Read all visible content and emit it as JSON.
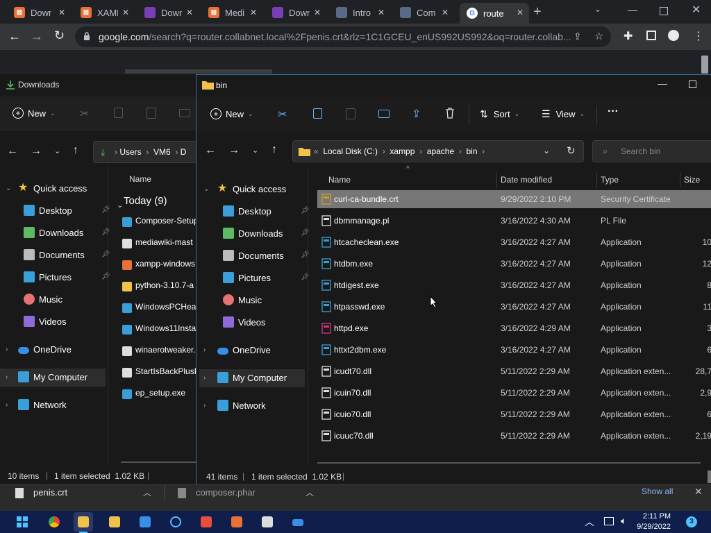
{
  "chrome": {
    "tabs": [
      {
        "title": "Down",
        "fav_color": "#e8703a",
        "fav_text": "⊠"
      },
      {
        "title": "XAMP",
        "fav_color": "#e8703a",
        "fav_text": "⊠"
      },
      {
        "title": "Down",
        "fav_color": "#7b3fb5",
        "fav_text": ""
      },
      {
        "title": "Medi",
        "fav_color": "#e8703a",
        "fav_text": "⊠"
      },
      {
        "title": "Down",
        "fav_color": "#7b3fb5",
        "fav_text": ""
      },
      {
        "title": "Intro",
        "fav_color": "#5a6a8a",
        "fav_text": ""
      },
      {
        "title": "Com",
        "fav_color": "#5a6a8a",
        "fav_text": ""
      },
      {
        "title": "route",
        "fav_color": "#ffffff",
        "fav_text": "G"
      }
    ],
    "url_host": "google.com",
    "url_rest": "/search?q=router.collabnet.local%2Fpenis.crt&rlz=1C1GCEU_enUS992US992&oq=router.collab..."
  },
  "back_window": {
    "title": "Downloads",
    "new_label": "New",
    "breadcrumb": [
      "Users",
      "VM6",
      "D"
    ],
    "quick_access": "Quick access",
    "sidebar": [
      "Desktop",
      "Downloads",
      "Documents",
      "Pictures",
      "Music",
      "Videos"
    ],
    "onedrive": "OneDrive",
    "mycomputer": "My Computer",
    "network": "Network",
    "col_name": "Name",
    "group": "Today (9)",
    "files": [
      "Composer-Setup",
      "mediawiki-mast",
      "xampp-windows",
      "python-3.10.7-a",
      "WindowsPCHea",
      "Windows11Insta",
      "winaerotweaker.",
      "StartIsBackPlusP",
      "ep_setup.exe"
    ],
    "status_items": "10 items",
    "status_selected": "1 item selected  1.02 KB"
  },
  "front_window": {
    "title": "bin",
    "new_label": "New",
    "sort_label": "Sort",
    "view_label": "View",
    "more_label": "···",
    "breadcrumb": [
      "Local Disk (C:)",
      "xampp",
      "apache",
      "bin"
    ],
    "search_placeholder": "Search bin",
    "quick_access": "Quick access",
    "sidebar": [
      "Desktop",
      "Downloads",
      "Documents",
      "Pictures",
      "Music",
      "Videos"
    ],
    "onedrive": "OneDrive",
    "mycomputer": "My Computer",
    "network": "Network",
    "columns": {
      "name": "Name",
      "date": "Date modified",
      "type": "Type",
      "size": "Size"
    },
    "files": [
      {
        "name": "curl-ca-bundle.crt",
        "date": "9/29/2022 2:10 PM",
        "type": "Security Certificate",
        "size": ""
      },
      {
        "name": "dbmmanage.pl",
        "date": "3/16/2022 4:30 AM",
        "type": "PL File",
        "size": ""
      },
      {
        "name": "htcacheclean.exe",
        "date": "3/16/2022 4:27 AM",
        "type": "Application",
        "size": "10"
      },
      {
        "name": "htdbm.exe",
        "date": "3/16/2022 4:27 AM",
        "type": "Application",
        "size": "12"
      },
      {
        "name": "htdigest.exe",
        "date": "3/16/2022 4:27 AM",
        "type": "Application",
        "size": "8"
      },
      {
        "name": "htpasswd.exe",
        "date": "3/16/2022 4:27 AM",
        "type": "Application",
        "size": "11"
      },
      {
        "name": "httpd.exe",
        "date": "3/16/2022 4:29 AM",
        "type": "Application",
        "size": "3"
      },
      {
        "name": "httxt2dbm.exe",
        "date": "3/16/2022 4:27 AM",
        "type": "Application",
        "size": "6"
      },
      {
        "name": "icudt70.dll",
        "date": "5/11/2022 2:29 AM",
        "type": "Application exten...",
        "size": "28,7"
      },
      {
        "name": "icuin70.dll",
        "date": "5/11/2022 2:29 AM",
        "type": "Application exten...",
        "size": "2,9"
      },
      {
        "name": "icuio70.dll",
        "date": "5/11/2022 2:29 AM",
        "type": "Application exten...",
        "size": "6"
      },
      {
        "name": "icuuc70.dll",
        "date": "5/11/2022 2:29 AM",
        "type": "Application exten...",
        "size": "2,19"
      }
    ],
    "status_items": "41 items",
    "status_selected": "1 item selected  1.02 KB"
  },
  "download_bar": {
    "items": [
      "penis.crt",
      "composer.phar"
    ],
    "show_all": "Show all"
  },
  "taskbar": {
    "time": "2:11 PM",
    "date": "9/29/2022",
    "badge": "3"
  }
}
